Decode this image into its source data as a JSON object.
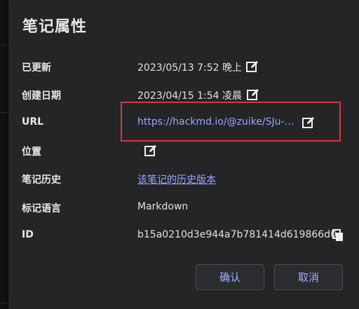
{
  "dialog": {
    "title": "笔记属性"
  },
  "properties": {
    "updated": {
      "label": "已更新",
      "value": "2023/05/13 7:52 晚上"
    },
    "created": {
      "label": "创建日期",
      "value": "2023/04/15 1:54 凌晨"
    },
    "url": {
      "label": "URL",
      "value": "https://hackmd.io/@zuike/SJu-…"
    },
    "location": {
      "label": "位置",
      "value": ""
    },
    "history": {
      "label": "笔记历史",
      "value": "该笔记的历史版本"
    },
    "language": {
      "label": "标记语言",
      "value": "Markdown"
    },
    "id": {
      "label": "ID",
      "value": "b15a0210d3e944a7b781414d619866d0"
    }
  },
  "buttons": {
    "ok": "确认",
    "cancel": "取消"
  },
  "icons": {
    "edit": "edit-icon",
    "copy": "copy-icon"
  },
  "colors": {
    "link": "#9aa6ff",
    "highlight": "#d6373c",
    "button_text": "#9fb1ff"
  }
}
